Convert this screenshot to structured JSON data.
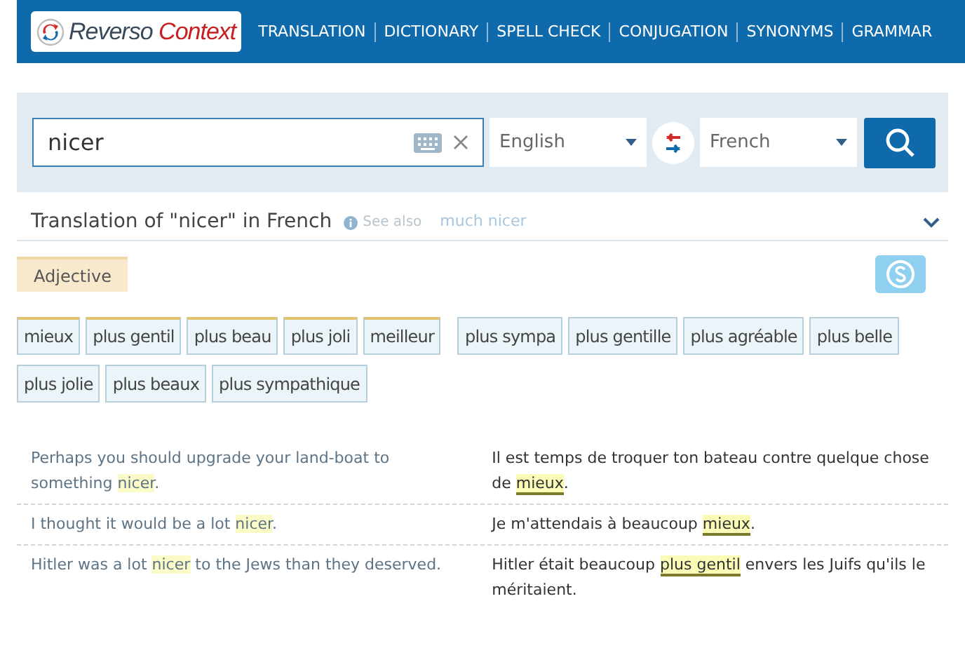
{
  "header": {
    "logo": {
      "word1": "Reverso",
      "word2": "Context"
    },
    "nav": [
      "TRANSLATION",
      "DICTIONARY",
      "SPELL CHECK",
      "CONJUGATION",
      "SYNONYMS",
      "GRAMMAR"
    ]
  },
  "search": {
    "value": "nicer",
    "source_language": "English",
    "target_language": "French"
  },
  "result": {
    "title": "Translation of \"nicer\" in French",
    "see_also_label": "See also",
    "see_also": [
      "much nicer"
    ],
    "expanded": false
  },
  "part_of_speech": "Adjective",
  "translations": [
    {
      "text": "mieux",
      "frequent": true
    },
    {
      "text": "plus gentil",
      "frequent": true
    },
    {
      "text": "plus beau",
      "frequent": true
    },
    {
      "text": "plus joli",
      "frequent": true
    },
    {
      "text": "meilleur",
      "frequent": true
    },
    {
      "text": "plus sympa",
      "frequent": false
    },
    {
      "text": "plus gentille",
      "frequent": false
    },
    {
      "text": "plus agréable",
      "frequent": false
    },
    {
      "text": "plus belle",
      "frequent": false
    },
    {
      "text": "plus jolie",
      "frequent": false
    },
    {
      "text": "plus beaux",
      "frequent": false
    },
    {
      "text": "plus sympathique",
      "frequent": false
    }
  ],
  "examples": [
    {
      "source": [
        {
          "text": "Perhaps you should upgrade your land-boat to something ",
          "highlight": false
        },
        {
          "text": "nicer",
          "highlight": true
        },
        {
          "text": ".",
          "highlight": false
        }
      ],
      "target": [
        {
          "text": "Il est temps de troquer ton bateau contre quelque chose de ",
          "highlight": false
        },
        {
          "text": "mieux",
          "highlight": true
        },
        {
          "text": ".",
          "highlight": false
        }
      ]
    },
    {
      "source": [
        {
          "text": "I thought it would be a lot ",
          "highlight": false
        },
        {
          "text": "nicer",
          "highlight": true
        },
        {
          "text": ".",
          "highlight": false
        }
      ],
      "target": [
        {
          "text": "Je m'attendais à beaucoup ",
          "highlight": false
        },
        {
          "text": "mieux",
          "highlight": true
        },
        {
          "text": ".",
          "highlight": false
        }
      ]
    },
    {
      "source": [
        {
          "text": "Hitler was a lot ",
          "highlight": false
        },
        {
          "text": "nicer",
          "highlight": true
        },
        {
          "text": " to the Jews than they deserved.",
          "highlight": false
        }
      ],
      "target": [
        {
          "text": "Hitler était beaucoup ",
          "highlight": false
        },
        {
          "text": "plus gentil",
          "highlight": true
        },
        {
          "text": " envers les Juifs qu'ils le méritaient.",
          "highlight": false
        }
      ]
    }
  ]
}
